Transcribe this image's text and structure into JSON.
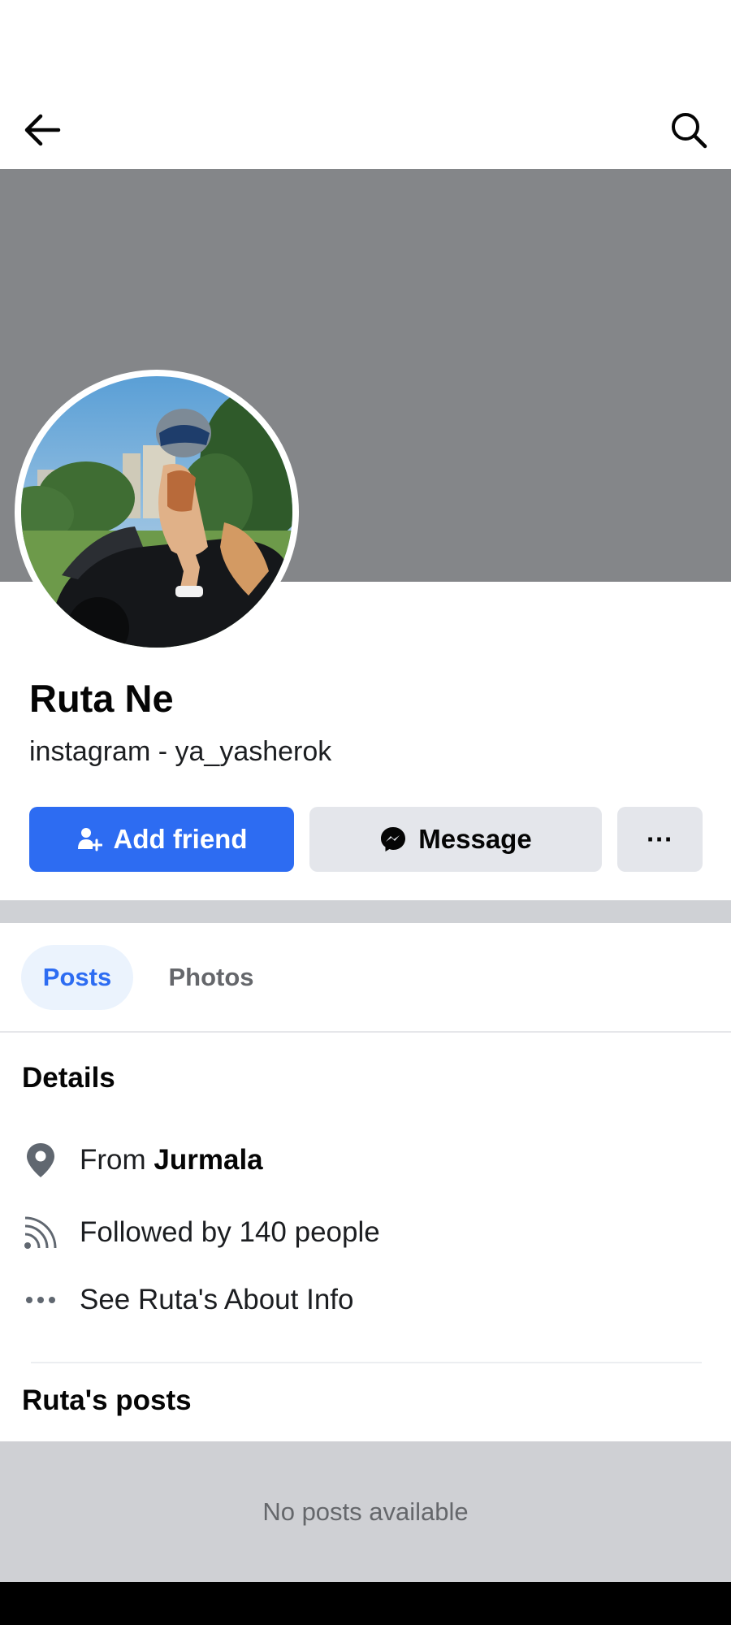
{
  "nav": {
    "back_icon": "arrow-left-icon",
    "search_icon": "search-icon"
  },
  "profile": {
    "name": "Ruta Ne",
    "bio": "instagram - ya_yasherok",
    "cover_color": "#848689"
  },
  "actions": {
    "add_friend_label": "Add friend",
    "message_label": "Message",
    "more_label": "···",
    "accent": "#2d6cf2"
  },
  "tabs": [
    {
      "label": "Posts",
      "active": true
    },
    {
      "label": "Photos",
      "active": false
    }
  ],
  "details": {
    "title": "Details",
    "from_prefix": "From ",
    "from_place": "Jurmala",
    "followed": "Followed by 140 people",
    "about": "See Ruta's About Info"
  },
  "posts": {
    "title": "Ruta's posts",
    "empty": "No posts available"
  }
}
